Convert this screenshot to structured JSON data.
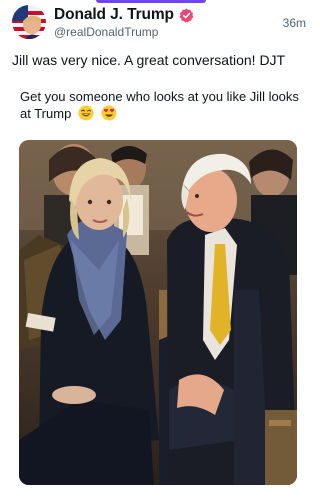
{
  "post": {
    "display_name": "Donald J. Trump",
    "handle": "@realDonaldTrump",
    "timestamp": "36m",
    "text": "Jill was very nice. A great conversation! DJT"
  },
  "quote": {
    "text": "Get you someone who looks at you like Jill looks at Trump"
  },
  "colors": {
    "accent": "#6e44ff",
    "verified": "#e8457a",
    "text_secondary": "#536471"
  },
  "icons": [
    "flag-avatar-icon",
    "verified-badge-icon",
    "grinning-emoji-icon",
    "heart-eyes-emoji-icon"
  ]
}
